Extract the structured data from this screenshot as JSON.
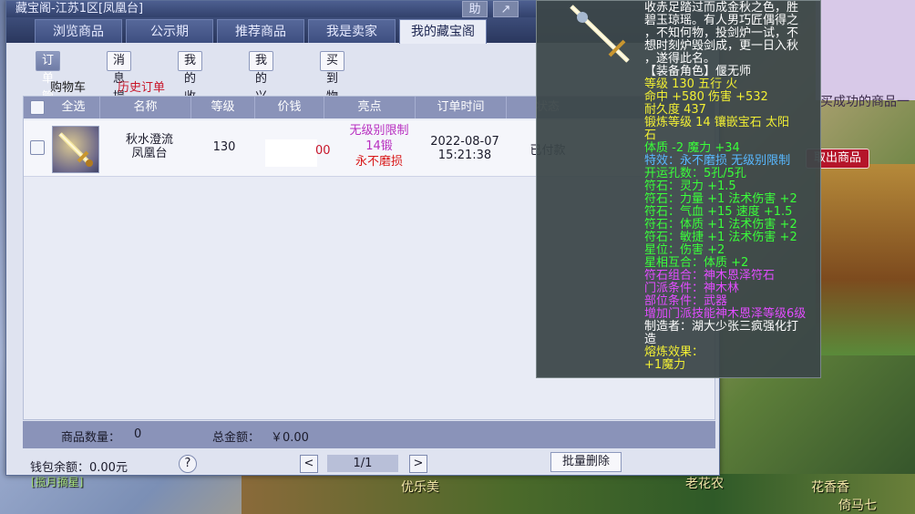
{
  "window": {
    "title": "藏宝阁-江苏1区[凤凰台]",
    "btn_help": "助",
    "tabs": [
      {
        "label": "浏览商品"
      },
      {
        "label": "公示期"
      },
      {
        "label": "推荐商品"
      },
      {
        "label": "我是卖家"
      },
      {
        "label": "我的藏宝阁"
      }
    ],
    "subtabs": [
      {
        "label": "订单管理"
      },
      {
        "label": "消息提醒"
      },
      {
        "label": "我的收藏"
      },
      {
        "label": "我的兴趣"
      },
      {
        "label": "买到物品"
      }
    ],
    "link_cart": "购物车",
    "link_history": "历史订单"
  },
  "table": {
    "headers": [
      "全选",
      "名称",
      "等级",
      "价钱",
      "亮点",
      "订单时间",
      "状态"
    ],
    "rows": [
      {
        "name": "秋水澄流\n凤凰台",
        "level": "130",
        "price_tail": "00",
        "highlights": [
          "无级别限制",
          "14锻",
          "永不磨损"
        ],
        "date": "2022-08-07",
        "time": "15:21:38",
        "status": "已付款"
      }
    ]
  },
  "footer": {
    "count_label": "商品数量：",
    "count_value": "0",
    "total_label": "总金额：",
    "total_value": "￥0.00",
    "wallet": "钱包余额：0.00元",
    "help": "?",
    "prev": "<",
    "next": ">",
    "page": "1/1",
    "batch_delete": "批量删除"
  },
  "tooltip": {
    "desc": [
      "收赤足踏过而成金秋之色，胜",
      "碧玉琼瑶。有人男巧匠偶得之",
      "，不知何物，投剑炉一试，不",
      "想时刻炉毁剑成，更一日入秋",
      "，遂得此名。"
    ],
    "equip_role": "【装备角色】偃无师",
    "stats": [
      "等级 130  五行 火",
      "命中 +580  伤害 +532",
      "耐久度 437",
      "锻炼等级 14  镶嵌宝石 太阳",
      "石"
    ],
    "gem_stats": [
      "体质 -2 魔力 +34"
    ],
    "special": "特效：永不磨损 无级别限制",
    "runes": [
      "开运孔数：5孔/5孔",
      "符石：灵力 +1.5",
      "符石：力量 +1 法术伤害 +2",
      "符石：气血 +15 速度 +1.5",
      "符石：体质 +1 法术伤害 +2",
      "符石：敏捷 +1 法术伤害 +2",
      "星位：伤害 +2"
    ],
    "xiang": "星相互合：体质 +2",
    "combo": [
      "符石组合：神木恩泽符石",
      "门派条件：神木林",
      "部位条件：武器",
      "增加门派技能神木恩泽等级6级"
    ],
    "maker": [
      "制造者：湖大少张三疯强化打",
      "造"
    ],
    "melt": [
      "熔炼效果：",
      "+1魔力"
    ]
  },
  "background": {
    "behind_text": "买成功的商品一",
    "npc1": "优乐美",
    "npc2": "老花农",
    "npc3": "花香香",
    "npc4": "倚马七",
    "bottom_left": "[揽月摘星]",
    "take_out": "取出商品"
  },
  "colors": {
    "title_bar": "#3e4f80",
    "header_row": "#8a93b9",
    "history_red": "#c8162a",
    "highlight_purple": "#b82fc0",
    "tooltip_bg": "#3c4648"
  }
}
